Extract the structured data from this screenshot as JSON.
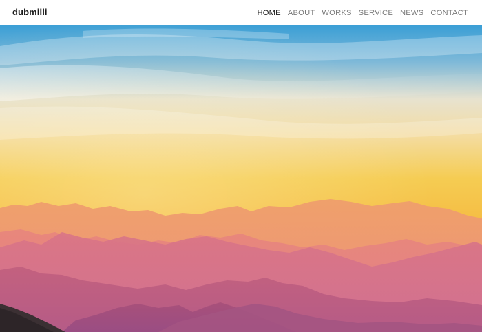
{
  "site": {
    "logo": "dubmilli"
  },
  "nav": {
    "items": [
      {
        "label": "HOME",
        "active": true
      },
      {
        "label": "ABOUT",
        "active": false
      },
      {
        "label": "WORKS",
        "active": false
      },
      {
        "label": "SERVICE",
        "active": false
      },
      {
        "label": "NEWS",
        "active": false
      },
      {
        "label": "CONTACT",
        "active": false
      }
    ]
  },
  "hero": {
    "image": "mountain-sunset-landscape",
    "colors": {
      "sky_top": "#4aa7d8",
      "sky_mid": "#f3e7c8",
      "sky_low": "#f5c842",
      "horizon": "#f2a23a",
      "haze": "#e9958a",
      "deep_mountain": "#b85a7e"
    }
  }
}
